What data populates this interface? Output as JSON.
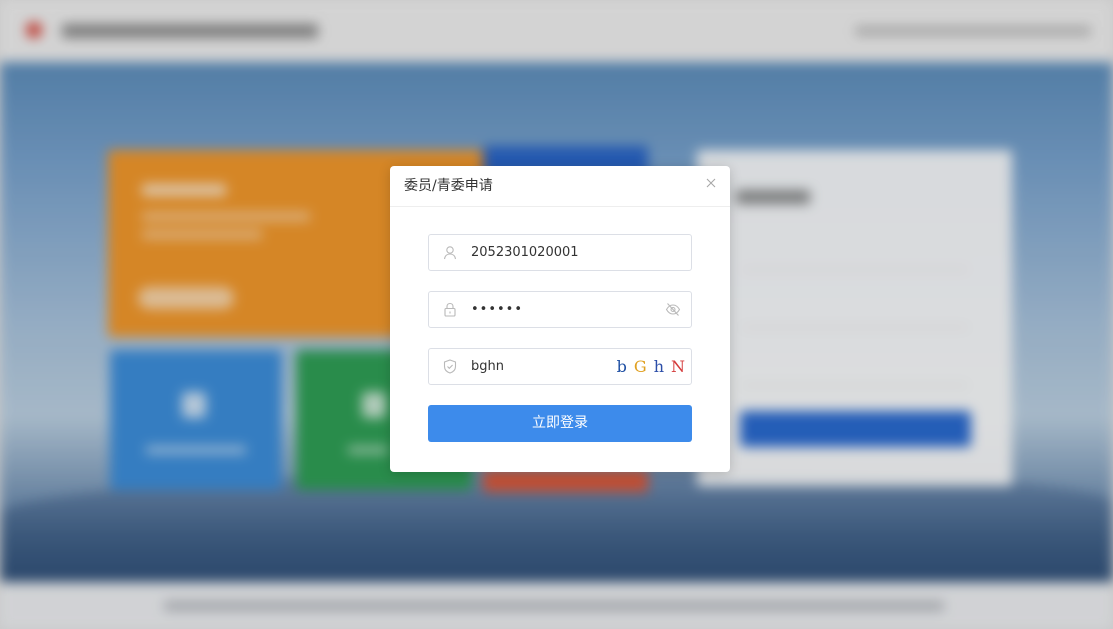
{
  "modal": {
    "title": "委员/青委申请",
    "close_symbol": "×",
    "username": {
      "value": "2052301020001",
      "icon": "user-icon"
    },
    "password": {
      "value": "••••••",
      "icon": "lock-icon",
      "toggle_icon": "eye-off-icon"
    },
    "captcha": {
      "value": "bghn",
      "icon": "shield-icon",
      "image_chars": [
        {
          "char": "b",
          "color": "#1e4fa3"
        },
        {
          "char": "G",
          "color": "#e0a020"
        },
        {
          "char": "h",
          "color": "#2c4ea8"
        },
        {
          "char": "N",
          "color": "#d43a3a"
        }
      ]
    },
    "login_button": {
      "label": "立即登录",
      "color": "#3d8beb"
    }
  },
  "colors": {
    "primary": "#3d8beb",
    "tile_orange": "#f3992c",
    "tile_blue": "#3d8fdc",
    "tile_green": "#2fa056",
    "tile_dark_blue": "#2a66c9",
    "tile_red": "#dd5a3c"
  }
}
